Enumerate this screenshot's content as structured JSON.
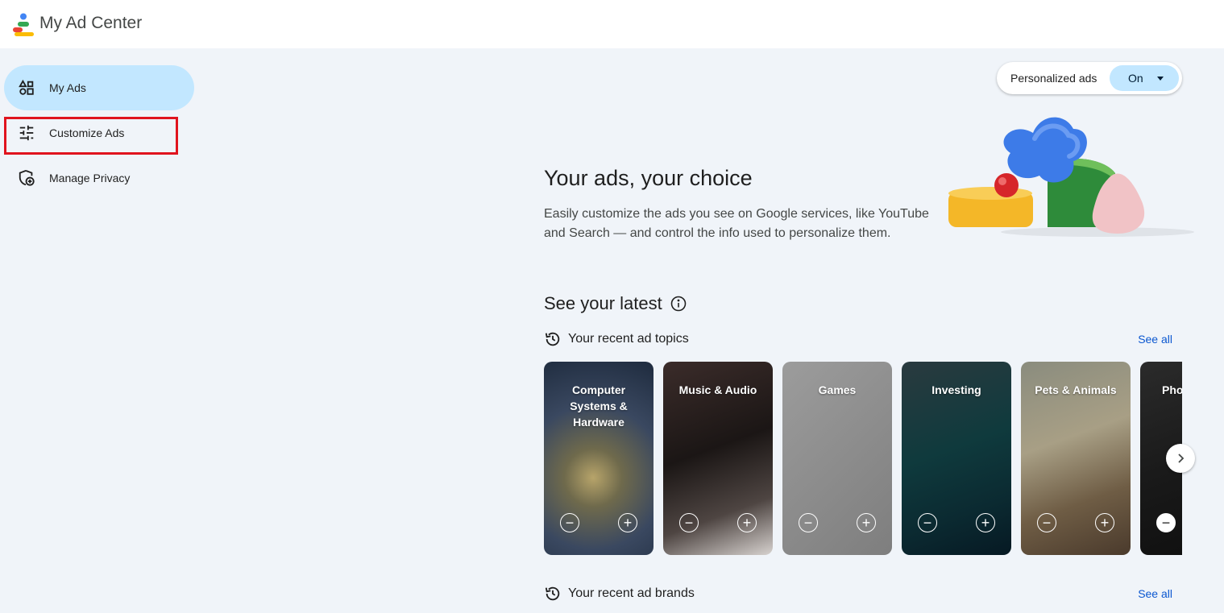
{
  "app": {
    "title": "My Ad Center"
  },
  "sidebar": {
    "items": [
      {
        "label": "My Ads",
        "icon": "my-ads-icon",
        "active": true
      },
      {
        "label": "Customize Ads",
        "icon": "sliders-icon",
        "highlighted": true
      },
      {
        "label": "Manage Privacy",
        "icon": "shield-privacy-icon"
      }
    ]
  },
  "personalized": {
    "label": "Personalized ads",
    "value": "On"
  },
  "hero": {
    "title": "Your ads, your choice",
    "description": "Easily customize the ads you see on Google services, like YouTube and Search — and control the info used to personalize them."
  },
  "latest": {
    "title": "See your latest",
    "topics": {
      "label": "Your recent ad topics",
      "see_all": "See all",
      "cards": [
        {
          "title": "Computer Systems & Hardware"
        },
        {
          "title": "Music & Audio"
        },
        {
          "title": "Games"
        },
        {
          "title": "Investing"
        },
        {
          "title": "Pets & Animals"
        },
        {
          "title": "Pho"
        }
      ]
    },
    "brands": {
      "label": "Your recent ad brands",
      "see_all": "See all"
    }
  },
  "colors": {
    "accent": "#c2e7ff",
    "link": "#0b57d0",
    "highlight": "#e0141e",
    "background": "#f0f4f9"
  }
}
